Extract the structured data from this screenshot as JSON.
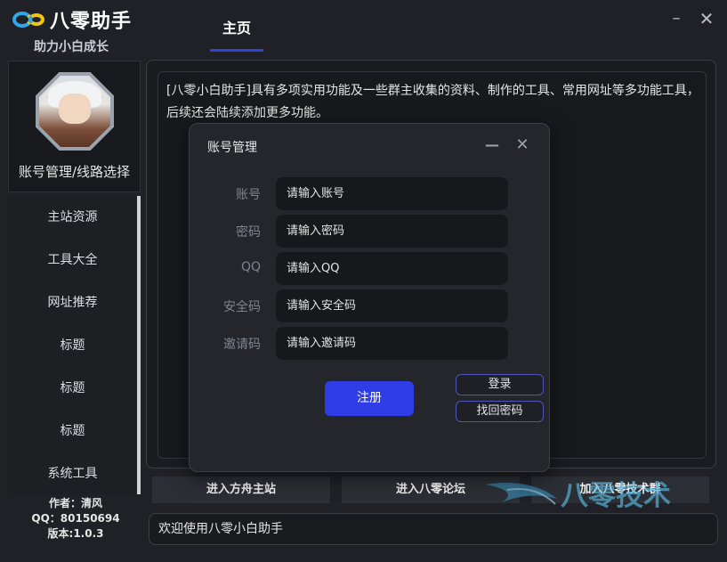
{
  "app": {
    "logo_text": "八零助手",
    "slogan": "助力小白成长",
    "tab_home": "主页",
    "window_controls": [
      "minimize-icon",
      "close-icon"
    ]
  },
  "sidebar": {
    "profile_label": "账号管理/线路选择",
    "items": [
      {
        "label": "主站资源"
      },
      {
        "label": "工具大全"
      },
      {
        "label": "网址推荐"
      },
      {
        "label": "标题"
      },
      {
        "label": "标题"
      },
      {
        "label": "标题"
      },
      {
        "label": "系统工具"
      }
    ],
    "author": "作者：清风",
    "qq": "QQ：80150694",
    "version": "版本:1.0.3"
  },
  "main": {
    "intro": "[八零小白助手]具有多项实用功能及一些群主收集的资料、制作的工具、常用网址等多功能工具，后续还会陆续添加更多功能。"
  },
  "bottom": {
    "buttons": [
      "进入方舟主站",
      "进入八零论坛",
      "加入八零技术群"
    ],
    "status": "欢迎使用八零小白助手",
    "watermark": "八零技术"
  },
  "dialog": {
    "title": "账号管理",
    "fields": [
      {
        "label": "账号",
        "placeholder": "请输入账号"
      },
      {
        "label": "密码",
        "placeholder": "请输入密码"
      },
      {
        "label": "QQ",
        "placeholder": "请输入QQ"
      },
      {
        "label": "安全码",
        "placeholder": "请输入安全码"
      },
      {
        "label": "邀请码",
        "placeholder": "请输入邀请码"
      }
    ],
    "register": "注册",
    "login": "登录",
    "recover": "找回密码"
  },
  "colors": {
    "background": "#1f2126",
    "accent": "#2f3de6",
    "tab_underline": "#2f44d9",
    "logo_blue": "#2fa7e8",
    "logo_yellow": "#f2c514"
  }
}
